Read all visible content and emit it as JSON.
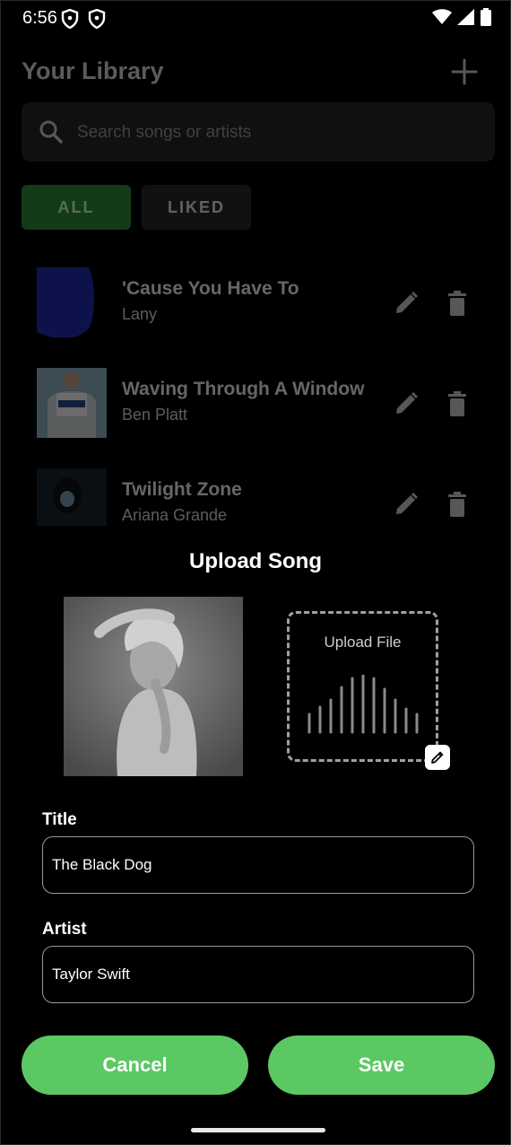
{
  "status_bar": {
    "time": "6:56"
  },
  "library": {
    "title": "Your Library",
    "search": {
      "placeholder": "Search songs or artists"
    },
    "filters": [
      {
        "label": "ALL"
      },
      {
        "label": "LIKED"
      }
    ],
    "songs": [
      {
        "title": "'Cause You Have To",
        "artist": "Lany"
      },
      {
        "title": "Waving Through A Window",
        "artist": "Ben Platt"
      },
      {
        "title": "Twilight Zone",
        "artist": "Ariana Grande"
      }
    ]
  },
  "upload": {
    "heading": "Upload Song",
    "upload_file_label": "Upload File",
    "title_label": "Title",
    "title_value": "The Black Dog",
    "artist_label": "Artist",
    "artist_value": "Taylor Swift",
    "cancel_label": "Cancel",
    "save_label": "Save"
  },
  "colors": {
    "accent": "#5cc863",
    "chip_active": "#2f8c3a",
    "background": "#000000"
  }
}
